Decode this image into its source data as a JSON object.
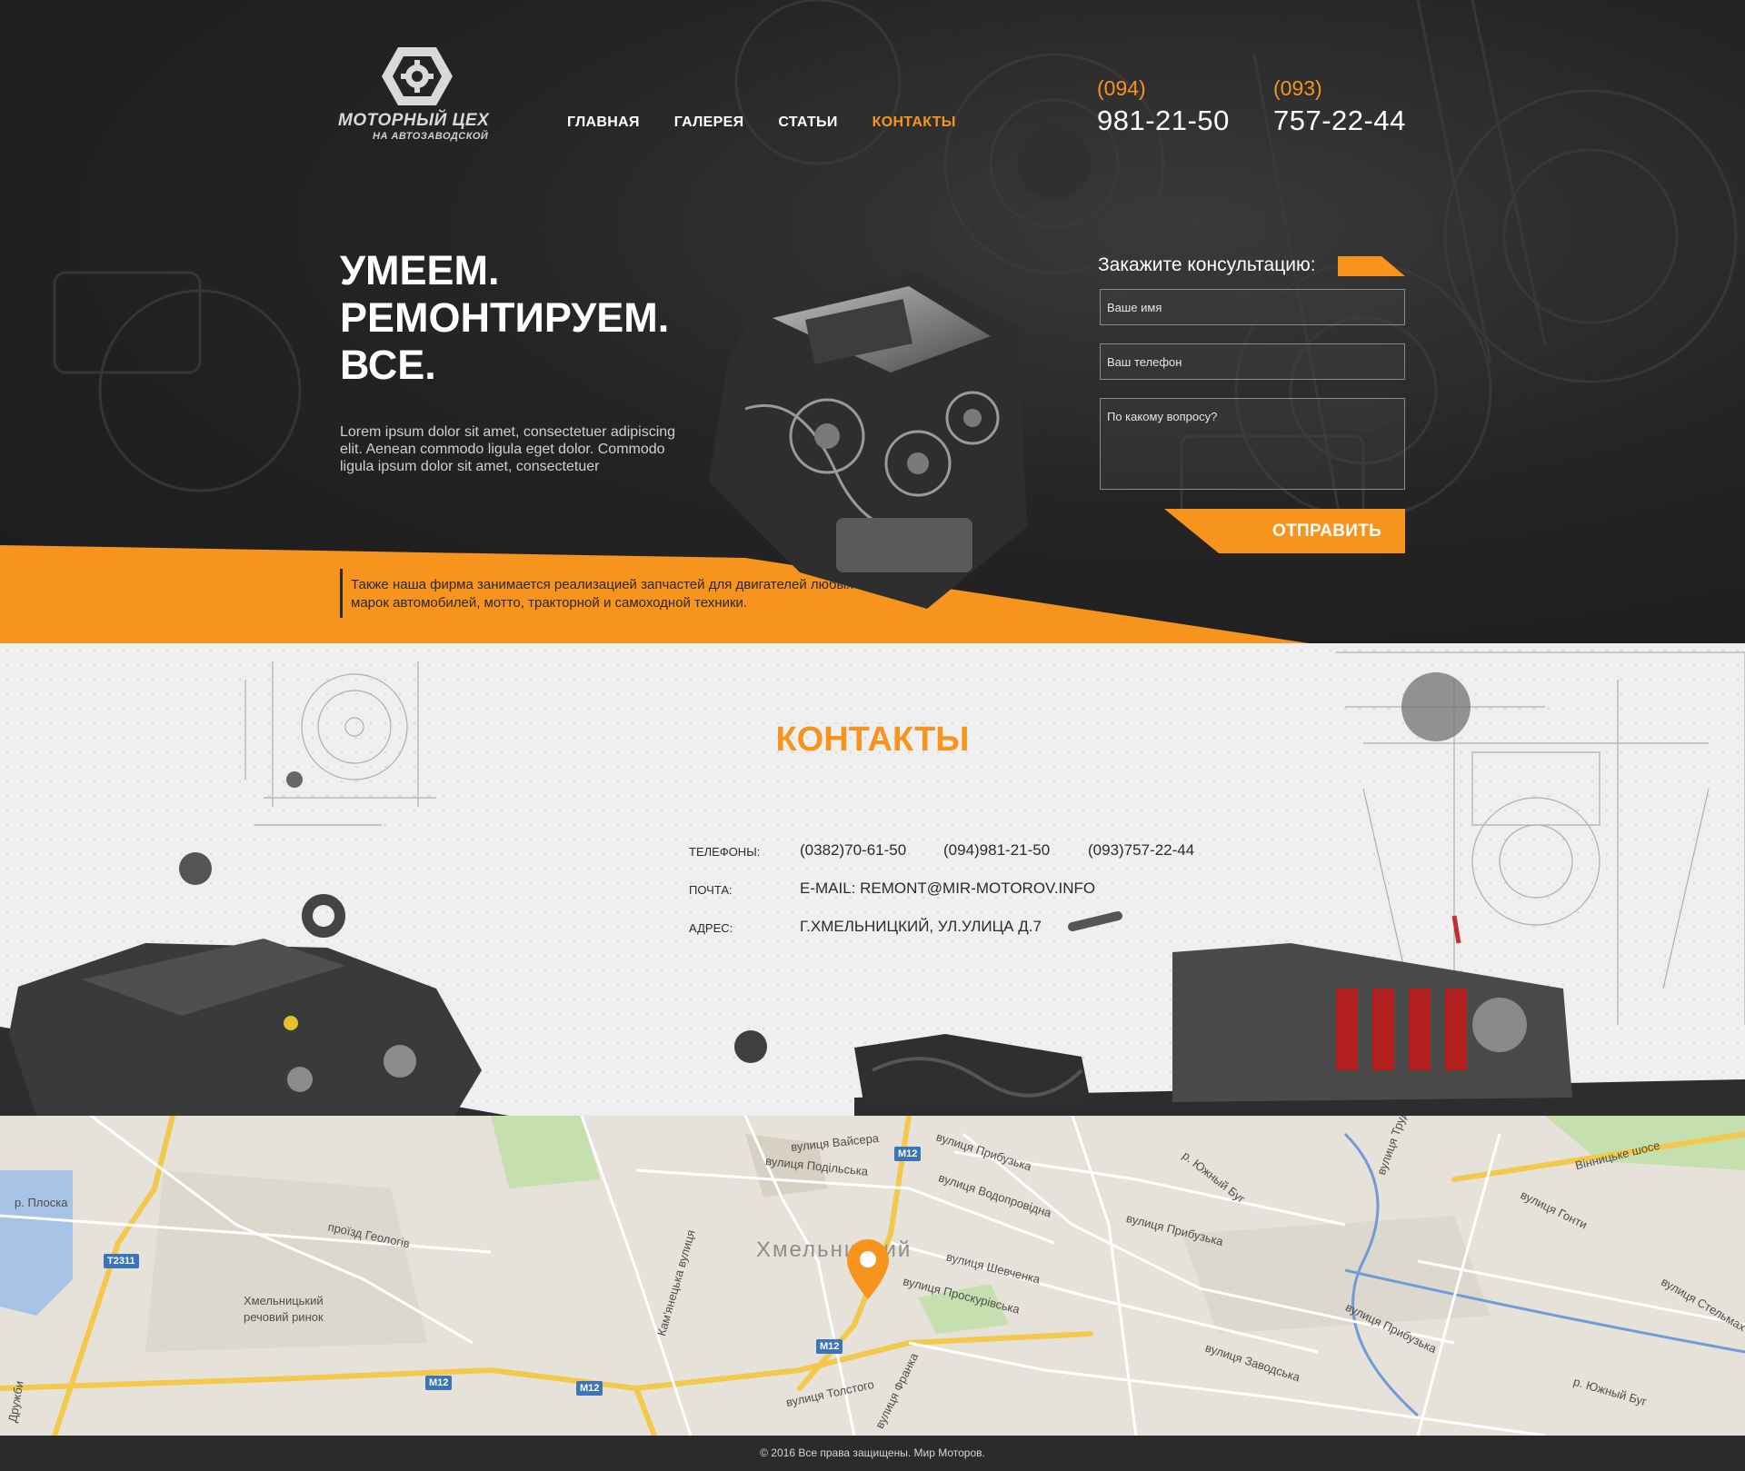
{
  "brand": {
    "title": "МОТОРНЫЙ ЦЕХ",
    "subtitle": "НА АВТОЗАВОДСКОЙ"
  },
  "nav": {
    "items": [
      "ГЛАВНАЯ",
      "ГАЛЕРЕЯ",
      "СТАТЬИ",
      "КОНТАКТЫ"
    ],
    "active": "КОНТАКТЫ"
  },
  "phones": [
    {
      "code": "(094)",
      "number": "981-21-50"
    },
    {
      "code": "(093)",
      "number": "757-22-44"
    }
  ],
  "hero": {
    "headline_1": "УМЕЕМ.",
    "headline_2": "РЕМОНТИРУЕМ.",
    "headline_3": "ВСЕ.",
    "lead": "Lorem ipsum dolor sit amet, consectetuer adipiscing elit. Aenean commodo ligula eget dolor. Commodo ligula ipsum dolor sit amet, consectetuer",
    "note": "Также наша фирма занимается реализацией запчастей для двигателей любых марок автомобилей, мотто, тракторной и самоходной техники."
  },
  "form": {
    "title": "Закажите консультацию:",
    "name_placeholder": "Ваше имя",
    "phone_placeholder": "Ваш телефон",
    "question_placeholder": "По какому вопросу?",
    "submit_label": "ОТПРАВИТЬ"
  },
  "contacts": {
    "title": "КОНТАКТЫ",
    "phones_label": "ТЕЛЕФОНЫ:",
    "phone_1": "(0382)70-61-50",
    "phone_2": "(094)981-21-50",
    "phone_3": "(093)757-22-44",
    "mail_label": "ПОЧТА:",
    "mail_value": "E-MAIL: REMONT@MIR-MOTOROV.INFO",
    "address_label": "АДРЕС:",
    "address_value": "Г.ХМЕЛЬНИЦКИЙ, УЛ.УЛИЦА Д.7"
  },
  "map": {
    "city": "Хмельницкий",
    "labels": {
      "plosca": "р. Плоска",
      "geologiv": "проїзд Геологів",
      "market_1": "Хмельницький",
      "market_2": "речовий ринок",
      "vaysera": "вулиця Вайсера",
      "podilska": "вулиця Подільська",
      "prybuzka_1": "вулиця Прибузька",
      "vodoprovidna": "вулиця Водопровідна",
      "prybuzka_2": "вулиця Прибузька",
      "shevchenka": "вулиця Шевченка",
      "proskurivska": "вулиця Проскурівська",
      "tolstoho": "вулиця Толстого",
      "zavodska": "вулиця Заводська",
      "prybuzka_3": "вулиця Прибузька",
      "kamyanetska": "Кам'янецька вулиця",
      "franka": "вулиця Франка",
      "southern_bug_1": "р. Южный Буг",
      "southern_bug_2": "р. Южный Буг",
      "vinnytske": "Вінницьке шосе",
      "honty": "вулиця Гонти",
      "stelmakha": "вулиця Стельмах",
      "druzhby": "Дружби",
      "truda": "вулиця Труда"
    },
    "badges": [
      "T2311",
      "M12",
      "M12",
      "M12",
      "M12"
    ]
  },
  "footer": {
    "text": "© 2016 Все права защищены. Мир Моторов."
  },
  "colors": {
    "accent": "#f7941d",
    "dark": "#242424",
    "light": "#efefef"
  }
}
